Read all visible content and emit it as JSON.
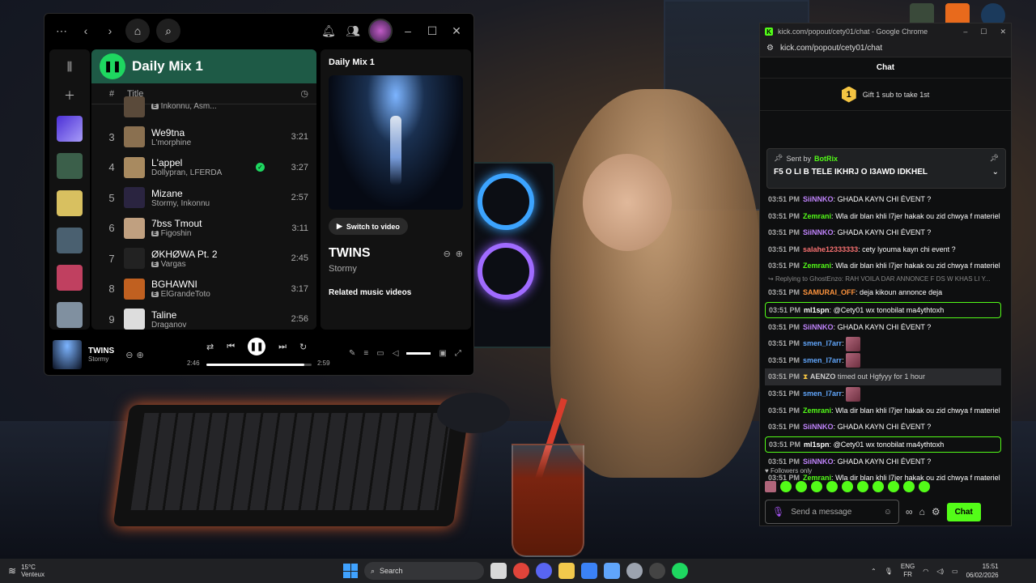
{
  "spotify": {
    "playlist_title": "Daily Mix 1",
    "col_number": "#",
    "col_title": "Title",
    "tracks": [
      {
        "num": "",
        "name": "",
        "artist": "Inkonnu, Asm...",
        "explicit": true,
        "duration": "",
        "art": "#5a4a3a"
      },
      {
        "num": "3",
        "name": "We9tna",
        "artist": "L'morphine",
        "explicit": false,
        "duration": "3:21",
        "art": "#8a7050"
      },
      {
        "num": "4",
        "name": "L'appel",
        "artist": "Dollypran, LFERDA",
        "explicit": false,
        "duration": "3:27",
        "saved": true,
        "art": "#a88a60"
      },
      {
        "num": "5",
        "name": "Mizane",
        "artist": "Stormy, Inkonnu",
        "explicit": false,
        "duration": "2:57",
        "art": "#2a2440"
      },
      {
        "num": "6",
        "name": "7bss Tmout",
        "artist": "Figoshin",
        "explicit": true,
        "duration": "3:11",
        "art": "#c0a080"
      },
      {
        "num": "7",
        "name": "ØKHØWA Pt. 2",
        "artist": "Vargas",
        "explicit": true,
        "duration": "2:45",
        "art": "#222"
      },
      {
        "num": "8",
        "name": "BGHAWNI",
        "artist": "ElGrandeToto",
        "explicit": true,
        "duration": "3:17",
        "art": "#c06020"
      },
      {
        "num": "9",
        "name": "Taline",
        "artist": "Draganov",
        "explicit": false,
        "duration": "2:56",
        "art": "#ddd"
      }
    ],
    "right_panel": {
      "heading": "Daily Mix 1",
      "switch_label": "Switch to video",
      "track_title": "TWINS",
      "track_artist": "Stormy",
      "related": "Related music videos"
    },
    "player": {
      "title": "TWINS",
      "artist": "Stormy",
      "elapsed": "2:46",
      "total": "2:59",
      "progress": 0.927
    }
  },
  "chrome": {
    "window_title": "kick.com/popout/cety01/chat - Google Chrome",
    "url": "kick.com/popout/cety01/chat",
    "chat_header": "Chat",
    "gift_count": "1",
    "gift_text": "Gift 1 sub to take 1st",
    "pinned": {
      "sent_by": "Sent by",
      "sender": "BotRix",
      "message": "F5 O LI B TELE IKHRJ O I3AWD IDKHEL"
    },
    "messages": [
      {
        "time": "03:51 PM",
        "user": "SiiNNKO",
        "color": "#c084fc",
        "text": "GHADA KAYN CHI ÉVENT ?"
      },
      {
        "time": "03:51 PM",
        "user": "Zemrani",
        "color": "#53fc18",
        "text": "Wla dir blan khli l7jer hakak ou zid chwya f materiel"
      },
      {
        "time": "03:51 PM",
        "user": "SiiNNKO",
        "color": "#c084fc",
        "text": "GHADA KAYN CHI ÉVENT ?"
      },
      {
        "time": "03:51 PM",
        "user": "salahe12333333",
        "color": "#f87171",
        "text": "cety lyouma kayn chi event ?"
      },
      {
        "time": "03:51 PM",
        "user": "Zemrani",
        "color": "#53fc18",
        "text": "Wla dir blan khli l7jer hakak ou zid chwya f materiel"
      },
      {
        "reply": "Replying to GhostEnzo: RAH VOILA DAR ANNONCE F DS W KHAS LI Y..."
      },
      {
        "time": "03:51 PM",
        "user": "SAMURAI_OFF",
        "color": "#fb923c",
        "text": "deja kikoun annonce deja"
      },
      {
        "time": "03:51 PM",
        "user": "ml1spn",
        "color": "#fff",
        "text": "@Cety01 wx tonobilat ma4ythtoxh",
        "highlight": true
      },
      {
        "time": "03:51 PM",
        "user": "SiiNNKO",
        "color": "#c084fc",
        "text": "GHADA KAYN CHI ÉVENT ?"
      },
      {
        "time": "03:51 PM",
        "user": "smen_l7arr",
        "color": "#60a5fa",
        "text": "",
        "emote": true
      },
      {
        "time": "03:51 PM",
        "user": "smen_l7arr",
        "color": "#60a5fa",
        "text": "",
        "emote": true
      },
      {
        "time": "03:51 PM",
        "user": "AENZO",
        "color": "#ccc",
        "text": "timed out Hgfyyy for 1 hour",
        "system": true
      },
      {
        "time": "03:51 PM",
        "user": "smen_l7arr",
        "color": "#60a5fa",
        "text": "",
        "emote": true
      },
      {
        "time": "03:51 PM",
        "user": "Zemrani",
        "color": "#53fc18",
        "text": "Wla dir blan khli l7jer hakak ou zid chwya f materiel"
      },
      {
        "time": "03:51 PM",
        "user": "SiiNNKO",
        "color": "#c084fc",
        "text": "GHADA KAYN CHI ÉVENT ?"
      },
      {
        "time": "03:51 PM",
        "user": "ml1spn",
        "color": "#fff",
        "text": "@Cety01 wx tonobilat ma4ythtoxh",
        "highlight": true
      },
      {
        "time": "03:51 PM",
        "user": "SiiNNKO",
        "color": "#c084fc",
        "text": "GHADA KAYN CHI ÉVENT ?"
      },
      {
        "time": "03:51 PM",
        "user": "Zemrani",
        "color": "#53fc18",
        "text": "Wla dir blan khli l7jer hakak ou zid chwya f materiel"
      }
    ],
    "followers_only": "Followers only",
    "input_placeholder": "Send a message",
    "chat_button": "Chat"
  },
  "taskbar": {
    "temp": "15°C",
    "weather": "Venteux",
    "search": "Search",
    "lang1": "ENG",
    "lang2": "FR",
    "time": "15:51",
    "date": "06/02/2026"
  }
}
